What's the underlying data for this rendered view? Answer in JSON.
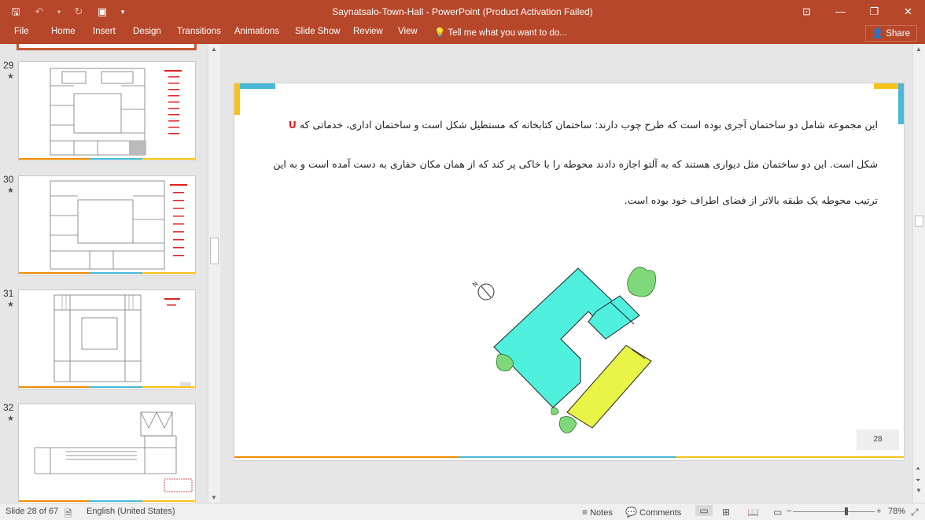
{
  "titlebar": {
    "title": "Saynatsalo-Town-Hall - PowerPoint (Product Activation Failed)",
    "qat": {
      "save": "🖫",
      "undo": "↶",
      "undo_more": "▾",
      "redo": "↻",
      "present": "▣",
      "customize": "▾"
    },
    "window": {
      "ribbon_opts": "⊡",
      "minimize": "—",
      "restore": "❐",
      "close": "✕"
    }
  },
  "ribbon": {
    "tabs": [
      "File",
      "Home",
      "Insert",
      "Design",
      "Transitions",
      "Animations",
      "Slide Show",
      "Review",
      "View"
    ],
    "tellme": "Tell me what you want to do...",
    "share": "Share"
  },
  "thumbnails": [
    {
      "number": "29",
      "star": "★"
    },
    {
      "number": "30",
      "star": "★"
    },
    {
      "number": "31",
      "star": "★"
    },
    {
      "number": "32",
      "star": "★"
    }
  ],
  "slide": {
    "line1_main": "این مجموعه شامل دو ساختمان آجری بوده است که طرح چوب دارند: ساختمان کتابخانه که مستطیل شکل است و ساختمان اداری، خدماتی که",
    "line1_letter": "U",
    "line2": "شکل است. این دو ساختمان مثل دیواری هستند که به آلتو اجازه دادند محوطه  را با خاکی پر کند که از همان مکان حفاری به دست آمده است و به این",
    "line3": "ترتیب محوطه  یک طبقه بالاتر از فضای اطراف خود بوده است.",
    "north_label": "N",
    "page_number": "28"
  },
  "statusbar": {
    "slide_info": "Slide 28 of 67",
    "language": "English (United States)",
    "notes": "Notes",
    "comments": "Comments",
    "zoom": "78%",
    "zoom_minus": "−",
    "zoom_plus": "+"
  },
  "colors": {
    "accent": "#b7472a",
    "orange": "#f18b00",
    "cyan": "#49b8d8",
    "yellow": "#f8c21c",
    "building_cyan": "#4ff0de",
    "building_yellow": "#e8f547",
    "vegetation": "#7fd97a"
  }
}
